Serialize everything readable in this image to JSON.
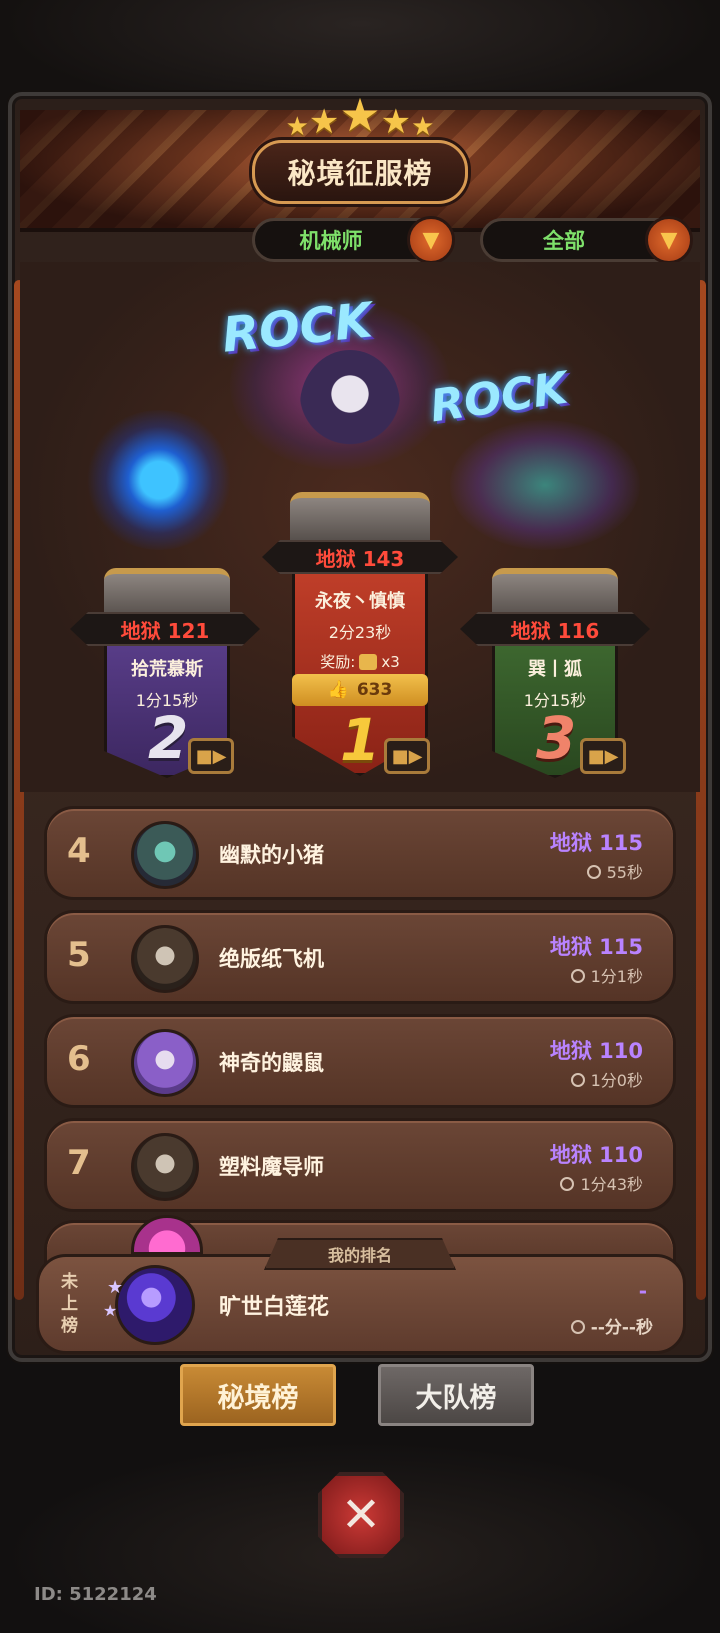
{
  "header": {
    "title": "秘境征服榜",
    "class_filter": "机械师",
    "scope_filter": "全部"
  },
  "podium": {
    "first": {
      "rank": "1",
      "score": "地狱 143",
      "name": "永夜丶慎慎",
      "time": "2分23秒",
      "reward_label": "奖励:",
      "reward_count": "x3",
      "likes": "633"
    },
    "second": {
      "rank": "2",
      "score": "地狱 121",
      "name": "拾荒慕斯",
      "time": "1分15秒"
    },
    "third": {
      "rank": "3",
      "score": "地狱 116",
      "name": "巽丨狐",
      "time": "1分15秒"
    }
  },
  "list": [
    {
      "rank": "4",
      "name": "幽默的小猪",
      "score": "地狱 115",
      "time": "55秒",
      "avatar_color": "#3b5a57"
    },
    {
      "rank": "5",
      "name": "绝版纸飞机",
      "score": "地狱 115",
      "time": "1分1秒",
      "avatar_color": "#4a3a2e"
    },
    {
      "rank": "6",
      "name": "神奇的鼹鼠",
      "score": "地狱 110",
      "time": "1分0秒",
      "avatar_color": "#8a5fc8"
    },
    {
      "rank": "7",
      "name": "塑料魔导师",
      "score": "地狱 110",
      "time": "1分43秒",
      "avatar_color": "#4a3a2e"
    }
  ],
  "my_rank": {
    "tab_label": "我的排名",
    "status": "未上榜",
    "name": "旷世白莲花",
    "score": "-",
    "time": "--分--秒"
  },
  "tabs": {
    "secret_realm": "秘境榜",
    "team": "大队榜"
  },
  "footer": {
    "id": "ID: 5122124"
  },
  "colors": {
    "hell_score_red": "#ff4b3b",
    "hell_score_purple": "#b983ff",
    "filter_green": "#7ee06a",
    "accent_orange": "#c88a35"
  }
}
